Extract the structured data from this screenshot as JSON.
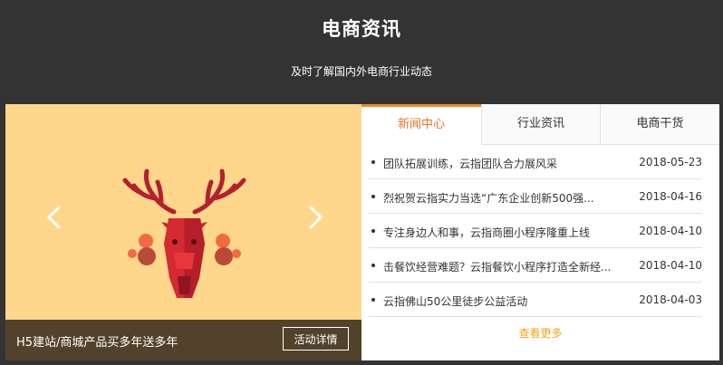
{
  "header": {
    "title": "电商资讯",
    "subtitle": "及时了解国内外电商行业动态"
  },
  "banner": {
    "caption": "H5建站/商城产品买多年送多年",
    "button_label": "活动详情",
    "bg_color": "#ffd78c"
  },
  "news": {
    "tabs": [
      {
        "label": "新闻中心",
        "active": true
      },
      {
        "label": "行业资讯",
        "active": false
      },
      {
        "label": "电商干货",
        "active": false
      }
    ],
    "items": [
      {
        "title": "团队拓展训练，云指团队合力展风采",
        "date": "2018-05-23"
      },
      {
        "title": "烈祝贺云指实力当选“广东企业创新500强...",
        "date": "2018-04-16"
      },
      {
        "title": "专注身边人和事，云指商圈小程序隆重上线",
        "date": "2018-04-10"
      },
      {
        "title": "击餐饮经营难题？云指餐饮小程序打造全新经...",
        "date": "2018-04-10"
      },
      {
        "title": "云指佛山50公里徒步公益活动",
        "date": "2018-04-03"
      }
    ],
    "more_label": "查看更多",
    "accent_color": "#f08a24"
  }
}
